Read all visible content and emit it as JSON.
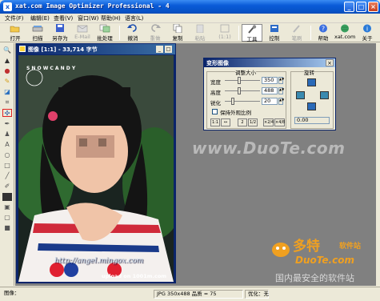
{
  "window": {
    "title": "xat.com  Image Optimizer Professional - 4",
    "icon": "xat-app-icon"
  },
  "menu": [
    "文件(F)",
    "编辑(E)",
    "查看(V)",
    "窗口(W)",
    "帮助(H)",
    "语言(L)"
  ],
  "toolbar": [
    {
      "label": "打开",
      "icon": "folder-open-icon",
      "enabled": true
    },
    {
      "label": "扫描",
      "icon": "scanner-icon",
      "enabled": true
    },
    {
      "label": "另存为",
      "icon": "save-as-icon",
      "enabled": true
    },
    {
      "label": "E-Mail",
      "icon": "email-icon",
      "enabled": false
    },
    {
      "label": "批处理",
      "icon": "batch-icon",
      "enabled": true
    },
    {
      "label": "撤消",
      "icon": "undo-icon",
      "enabled": true
    },
    {
      "label": "重做",
      "icon": "redo-icon",
      "enabled": false
    },
    {
      "label": "复制",
      "icon": "copy-icon",
      "enabled": true
    },
    {
      "label": "粘贴",
      "icon": "paste-icon",
      "enabled": false
    },
    {
      "label": "(1:1)",
      "icon": "zoom-actual-icon",
      "enabled": false
    },
    {
      "label": "工具",
      "icon": "tools-icon",
      "enabled": true,
      "pressed": true
    },
    {
      "label": "控制",
      "icon": "control-icon",
      "enabled": true
    },
    {
      "label": "笔刷",
      "icon": "brush-icon",
      "enabled": false
    },
    {
      "label": "帮助",
      "icon": "help-icon",
      "enabled": true
    },
    {
      "label": "xat.com",
      "icon": "globe-icon",
      "enabled": true
    },
    {
      "label": "关于",
      "icon": "about-icon",
      "enabled": true
    }
  ],
  "image_window": {
    "title": "图像 [1:1] - 33,714 字节"
  },
  "photo": {
    "tl_text": "S N O W  C A N D Y",
    "bottom_url": "http://angel.mingox.com",
    "credit": "upload on 1001m.com"
  },
  "dialog": {
    "title": "变形图像",
    "resize_group": "调整大小",
    "rotate_group": "旋转",
    "width_label": "宽度",
    "width_value": "350",
    "height_label": "高度",
    "height_value": "488",
    "sharpen_label": "锐化",
    "sharpen_value": "20",
    "keep_ratio_label": "保持外观比例",
    "ratio_value": "0.00",
    "size_buttons": [
      "1:1",
      "↔",
      "2",
      "1/2",
      "×2/4",
      "×4/8"
    ]
  },
  "status": {
    "left": "图像：",
    "info": "JPG 350x488  品质 = 75",
    "opt": "优化：无"
  },
  "watermark": {
    "site": "www.DuoTe.com",
    "brand": "多特",
    "brand2": "软件站",
    "url": "DuoTe.com",
    "slogan": "国内最安全的软件站"
  },
  "colors": {
    "titlebar": "#0a5bd8",
    "workspace": "#808080",
    "dialog_title": "#0a246a"
  }
}
